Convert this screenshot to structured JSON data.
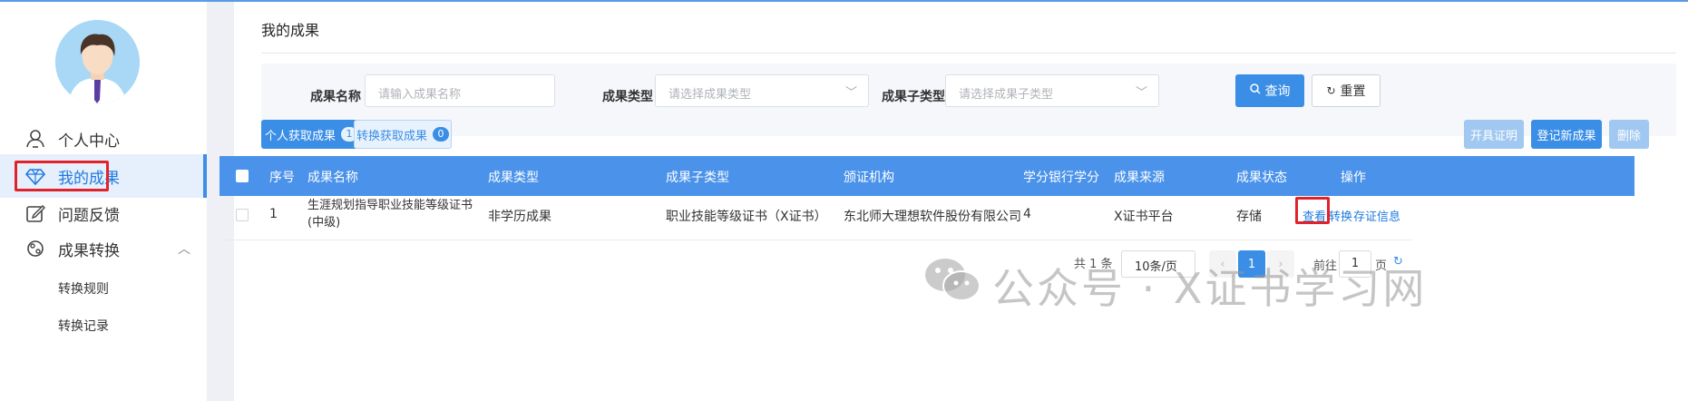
{
  "sidebar": {
    "items": [
      {
        "label": "个人中心",
        "icon": "user-icon"
      },
      {
        "label": "我的成果",
        "icon": "diamond-icon"
      },
      {
        "label": "问题反馈",
        "icon": "edit-icon"
      },
      {
        "label": "成果转换",
        "icon": "convert-icon"
      }
    ],
    "sub_items": [
      "转换规则",
      "转换记录"
    ]
  },
  "page": {
    "title": "我的成果"
  },
  "filter": {
    "name_label": "成果名称",
    "name_placeholder": "请输入成果名称",
    "type_label": "成果类型",
    "type_placeholder": "请选择成果类型",
    "subtype_label": "成果子类型",
    "subtype_placeholder": "请选择成果子类型",
    "query_label": "查询",
    "reset_label": "重置"
  },
  "tabs": [
    {
      "label": "个人获取成果",
      "count": "1"
    },
    {
      "label": "转换获取成果",
      "count": "0"
    }
  ],
  "actions": {
    "certify": "开具证明",
    "register": "登记新成果",
    "delete": "删除"
  },
  "table": {
    "headers": [
      "序号",
      "成果名称",
      "成果类型",
      "成果子类型",
      "颁证机构",
      "学分银行学分",
      "成果来源",
      "成果状态",
      "操作"
    ],
    "rows": [
      {
        "index": "1",
        "name": "生涯规划指导职业技能等级证书(中级)",
        "type": "非学历成果",
        "subtype": "职业技能等级证书（X证书）",
        "org": "东北师大理想软件股份有限公司",
        "credits": "4",
        "source": "X证书平台",
        "status": "存储",
        "ops": [
          "查看",
          "转换",
          "存证信息"
        ]
      }
    ]
  },
  "pagination": {
    "total": "共 1 条",
    "page_size": "10条/页",
    "current": "1",
    "goto_label": "前往",
    "goto_value": "1",
    "page_unit": "页"
  },
  "watermark": "公众号 · X证书学习网",
  "colors": {
    "accent": "#3a8ee6",
    "highlight": "#e0232b",
    "table_header": "#4a92ea"
  }
}
